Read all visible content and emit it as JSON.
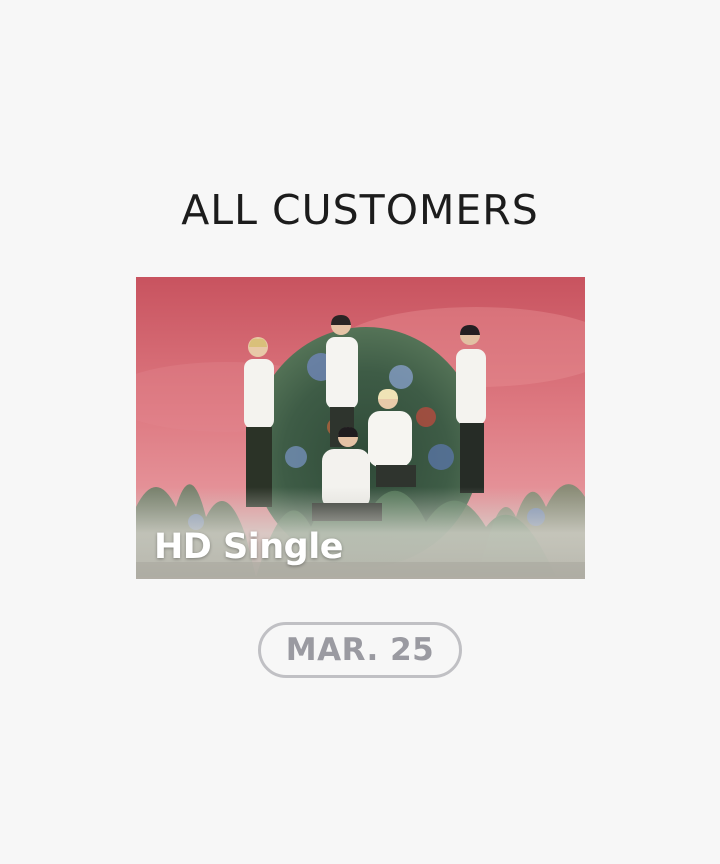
{
  "page": {
    "title": "ALL CUSTOMERS"
  },
  "banner": {
    "label": "HD Single",
    "image": "group-photo-pink-sky-flowers"
  },
  "date_badge": {
    "text": "MAR. 25"
  },
  "colors": {
    "background": "#f7f7f7",
    "title": "#1c1c1c",
    "pill_border": "#c0c0c4",
    "pill_text": "#9a9aa1",
    "sky": "#d9707a"
  }
}
